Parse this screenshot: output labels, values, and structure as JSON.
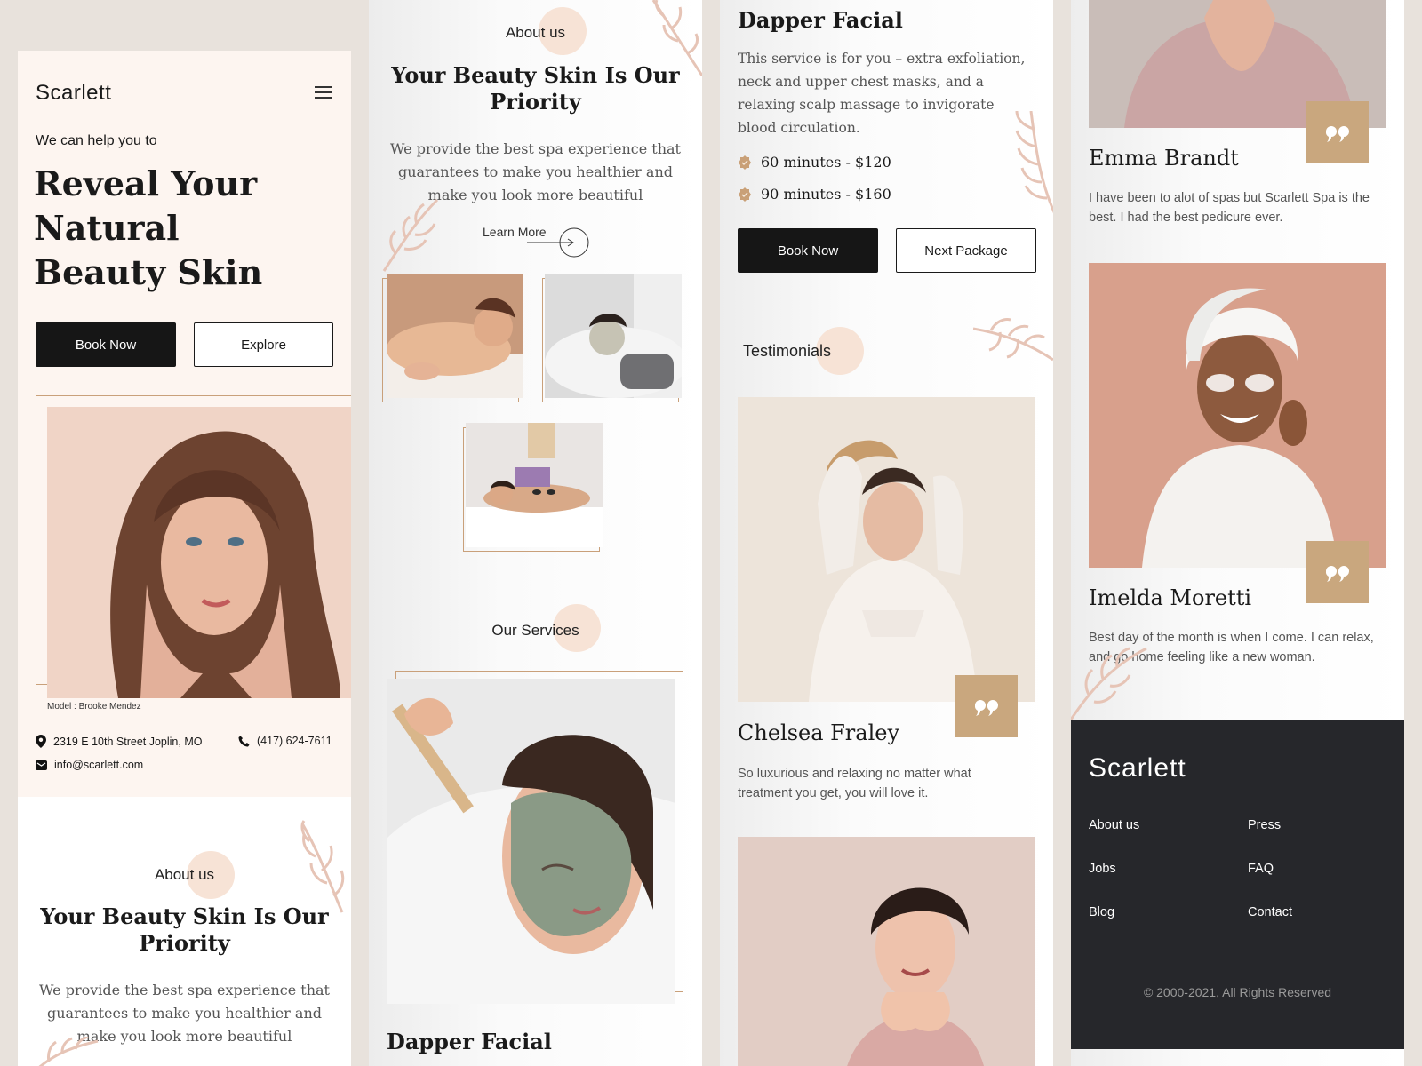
{
  "col1": {
    "brand": "Scarlett",
    "kicker": "We can help you to",
    "headline_1": "Reveal Your",
    "headline_2": "Natural",
    "headline_3": "Beauty Skin",
    "book_now": "Book Now",
    "explore": "Explore",
    "model_caption": "Model : Brooke Mendez",
    "address": "2319 E 10th Street Joplin, MO",
    "phone": "(417) 624-7611",
    "email": "info@scarlett.com",
    "about_label": "About us",
    "about_title_1": "Your Beauty Skin Is Our",
    "about_title_2": "Priority",
    "about_text": "We provide the best spa experience that guarantees to make you healthier and make you look more beautiful"
  },
  "col2": {
    "about_label": "About us",
    "about_title_1": "Your Beauty Skin Is Our",
    "about_title_2": "Priority",
    "about_text": "We provide the best spa experience that guarantees to make you healthier and make you look more beautiful",
    "learn_more": "Learn More",
    "services_label": "Our Services",
    "service_title": "Dapper Facial"
  },
  "col3": {
    "service_title": "Dapper Facial",
    "service_text": "This service is for you – extra exfoliation, neck and upper chest masks, and a relaxing scalp massage to invigorate blood circulation.",
    "price_1": "60 minutes - $120",
    "price_2": "90 minutes - $160",
    "book_now": "Book Now",
    "next_package": "Next Package",
    "testimonials_label": "Testimonials",
    "t1_name": "Chelsea Fraley",
    "t1_text": "So luxurious and relaxing no matter what treatment you get, you will love it."
  },
  "col4": {
    "t2_name": "Emma Brandt",
    "t2_text": "I have been to alot of spas but Scarlett Spa is the best. I had the best pedicure ever.",
    "t3_name": "Imelda Moretti",
    "t3_text": "Best day of the month is when I come. I can relax, and go home feeling like a new woman.",
    "footer_brand": "Scarlett",
    "footer_links": [
      "About us",
      "Press",
      "Jobs",
      "FAQ",
      "Blog",
      "Contact"
    ],
    "copyright": "© 2000-2021, All Rights Reserved"
  },
  "colors": {
    "accent": "#c9a77e",
    "dark": "#161616",
    "cream": "#fdf5f0",
    "footer": "#26272b"
  },
  "icons": [
    "menu-icon",
    "location-pin-icon",
    "phone-icon",
    "mail-icon",
    "arrow-right-icon",
    "quote-icon",
    "badge-check-icon",
    "leaf-icon"
  ]
}
